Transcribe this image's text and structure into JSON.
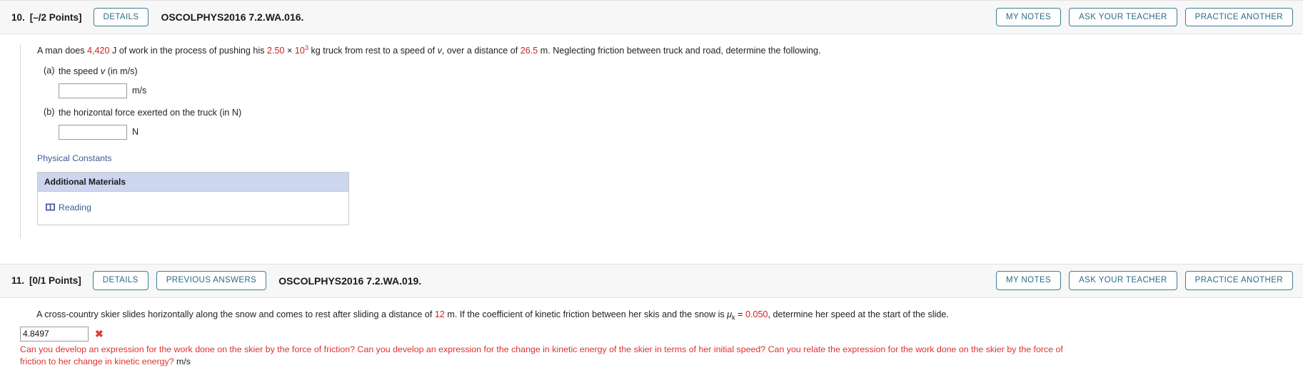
{
  "questions": [
    {
      "number": "10.",
      "points": "[–/2 Points]",
      "buttons_left": [
        "DETAILS"
      ],
      "code": "OSCOLPHYS2016 7.2.WA.016.",
      "buttons_right": [
        "MY NOTES",
        "ASK YOUR TEACHER",
        "PRACTICE ANOTHER"
      ],
      "stem": {
        "t1": "A man does ",
        "v1": "4,420",
        "t2": " J of work in the process of pushing his ",
        "v2": "2.50",
        "t3": " × ",
        "v3": "10",
        "v3exp": "3",
        "t4": " kg truck from rest to a speed of ",
        "vel": "v",
        "t5": ", over a distance of ",
        "v4": "26.5",
        "t6": " m. Neglecting friction between truck and road, determine the following."
      },
      "parts": [
        {
          "label": "(a)",
          "text_before": "the speed ",
          "text_italic": "v",
          "text_after": " (in m/s)",
          "value": "",
          "placeholder": "",
          "unit": "m/s"
        },
        {
          "label": "(b)",
          "text_before": "the horizontal force exerted on the truck (in N)",
          "text_italic": "",
          "text_after": "",
          "value": "",
          "placeholder": "",
          "unit": "N"
        }
      ],
      "physical_constants_label": "Physical Constants",
      "additional_materials": {
        "header": "Additional Materials",
        "items": [
          {
            "label": "Reading",
            "icon": "book-icon"
          }
        ]
      }
    },
    {
      "number": "11.",
      "points": "[0/1 Points]",
      "buttons_left": [
        "DETAILS",
        "PREVIOUS ANSWERS"
      ],
      "code": "OSCOLPHYS2016 7.2.WA.019.",
      "buttons_right": [
        "MY NOTES",
        "ASK YOUR TEACHER",
        "PRACTICE ANOTHER"
      ],
      "stem": {
        "t1": "A cross-country skier slides horizontally along the snow and comes to rest after sliding a distance of ",
        "v1": "12",
        "t2": " m. If the coefficient of kinetic friction between her skis and the snow is ",
        "mu": "μ",
        "musub": "k",
        "t3": " = ",
        "v2": "0.050",
        "t4": ", determine her speed at the start of the slide."
      },
      "answer": {
        "value": "4.8497",
        "status_icon": "cross-mark-icon",
        "status": "incorrect"
      },
      "feedback": {
        "text": "Can you develop an expression for the work done on the skier by the force of friction? Can you develop an expression for the change in kinetic energy of the skier in terms of her initial speed? Can you relate the expression for the work done on the skier by the force of friction to her change in kinetic energy?",
        "unit": "m/s"
      }
    }
  ],
  "colors": {
    "accent_blue": "#2a6b84",
    "value_red": "#cc2222",
    "error_red": "#e03030",
    "link_blue": "#3b5998",
    "table_header_blue": "#ccd6ef",
    "header_bg": "#f7f7f7"
  }
}
